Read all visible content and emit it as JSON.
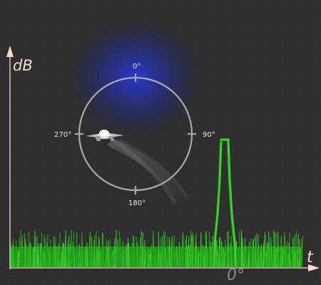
{
  "diagram": {
    "y_axis_label": "dB",
    "x_axis_label": "t",
    "peak_label": "0°",
    "bearings": {
      "north": "0°",
      "east": "90°",
      "south": "180°",
      "west": "270°"
    }
  },
  "colors": {
    "background": "#2d2d2d",
    "axes": "#f2dcc8",
    "signal": "#3bd12c",
    "compass": "#a9a9a9",
    "glow": "#2a38d6"
  },
  "icons": {
    "aircraft": "airplane-icon"
  }
}
